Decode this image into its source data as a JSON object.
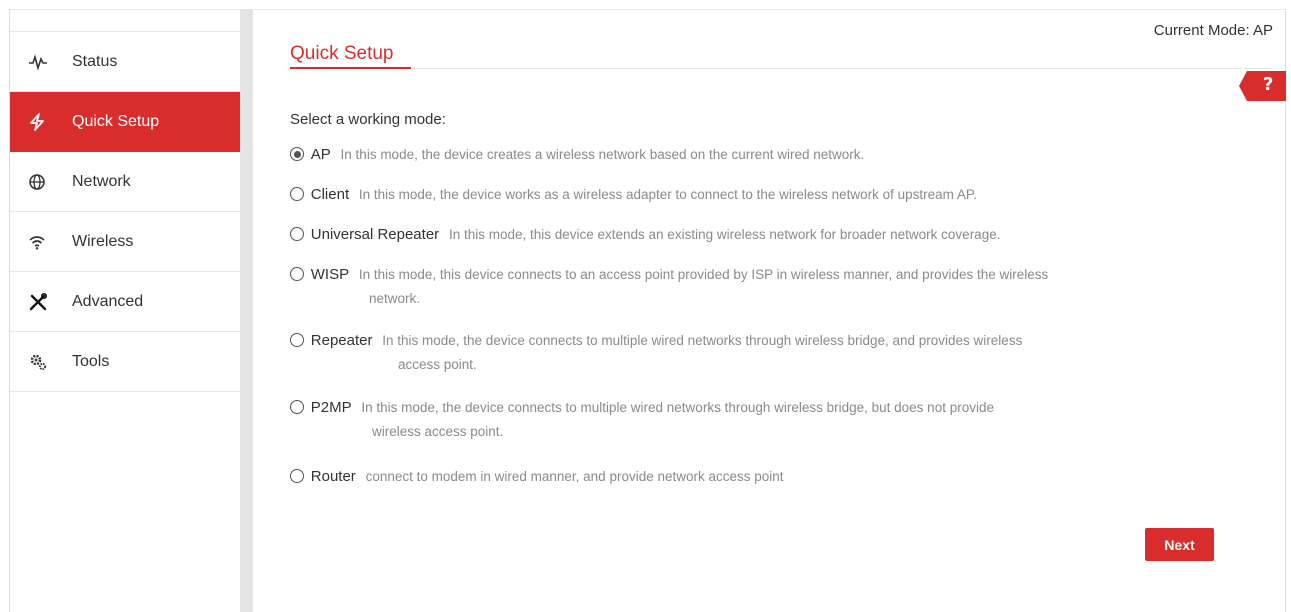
{
  "header": {
    "current_mode": "Current Mode: AP",
    "page_title": "Quick Setup",
    "help_label": "?"
  },
  "sidebar": {
    "items": [
      {
        "label": "Status",
        "icon": "pulse-icon",
        "active": false
      },
      {
        "label": "Quick Setup",
        "icon": "lightning-icon",
        "active": true
      },
      {
        "label": "Network",
        "icon": "globe-icon",
        "active": false
      },
      {
        "label": "Wireless",
        "icon": "wifi-icon",
        "active": false
      },
      {
        "label": "Advanced",
        "icon": "tools-icon",
        "active": false
      },
      {
        "label": "Tools",
        "icon": "gears-icon",
        "active": false
      }
    ]
  },
  "main": {
    "prompt": "Select a working mode:",
    "modes": [
      {
        "name": "AP",
        "desc": "In this mode, the device creates a wireless network based on the current wired network.",
        "desc2": "",
        "checked": true
      },
      {
        "name": "Client",
        "desc": "In this mode, the device works as a wireless adapter to connect to the wireless network of upstream AP.",
        "desc2": "",
        "checked": false
      },
      {
        "name": "Universal Repeater",
        "desc": "In this mode, this device extends an existing wireless network for broader network coverage.",
        "desc2": "",
        "checked": false
      },
      {
        "name": "WISP",
        "desc": "In this mode, this device connects to an access point provided by ISP in wireless manner, and provides the wireless",
        "desc2": "network.",
        "checked": false
      },
      {
        "name": "Repeater",
        "desc": "In this mode, the device connects to multiple wired networks through wireless bridge, and provides wireless",
        "desc2": "access point.",
        "checked": false
      },
      {
        "name": "P2MP",
        "desc": "In this mode, the device connects to multiple wired networks through wireless bridge, but does not provide",
        "desc2": "wireless access point.",
        "checked": false
      },
      {
        "name": "Router",
        "desc": "connect to modem in wired manner, and provide network access point",
        "desc2": "",
        "checked": false
      }
    ],
    "next_label": "Next"
  },
  "colors": {
    "accent": "#d92d2d",
    "sidebar_separator": "#e4e4e4",
    "description_text": "#8a8a8a"
  }
}
